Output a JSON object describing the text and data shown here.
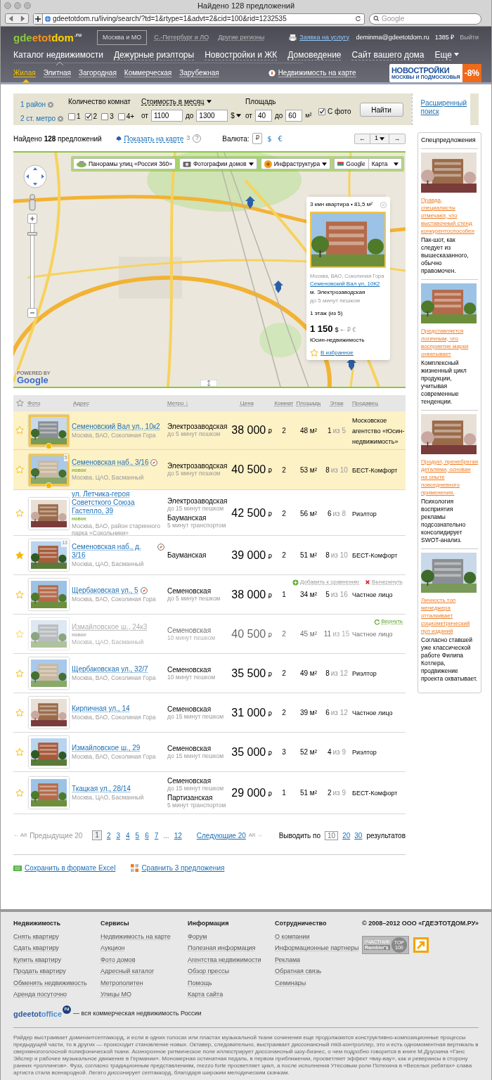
{
  "browser": {
    "title": "Найдено 128 предложений",
    "url": "gdeetotdom.ru/living/search/?td=1&rtype=1&advt=2&cid=100&rid=1232535",
    "search_placeholder": "Google"
  },
  "header": {
    "logo": [
      {
        "text": "gde",
        "color": "#8cc63f"
      },
      {
        "text": "etot",
        "color": "#f7941d"
      },
      {
        "text": "dom",
        "color": "#ffd200"
      }
    ],
    "logo_suffix": ".ru",
    "regions": [
      {
        "label": "Москва и МО",
        "selected": true
      },
      {
        "label": "С.-Петербург и ЛО",
        "selected": false
      },
      {
        "label": "Другие регионы",
        "selected": false
      }
    ],
    "service_link": "Заявка на услугу",
    "user": "deminma@gdeetotdom.ru",
    "balance": "1385 ₽",
    "logout": "Выйти",
    "nav": [
      {
        "label": "Каталог недвижимости",
        "selected": true,
        "dropdown": false
      },
      {
        "label": "Дежурные риэлторы",
        "selected": false,
        "dropdown": false
      },
      {
        "label": "Новостройки и ЖК",
        "selected": false,
        "dropdown": false
      },
      {
        "label": "Домоведение",
        "selected": false,
        "dropdown": false
      },
      {
        "label": "Сайт вашего дома",
        "selected": false,
        "dropdown": false
      },
      {
        "label": "Еще",
        "selected": false,
        "dropdown": true
      }
    ],
    "subnav": [
      {
        "label": "Жилая",
        "selected": true
      },
      {
        "label": "Элитная",
        "selected": false
      },
      {
        "label": "Загородная",
        "selected": false
      },
      {
        "label": "Коммерческая",
        "selected": false
      },
      {
        "label": "Зарубежная",
        "selected": false
      }
    ],
    "map_link": "Недвижимость на карте",
    "banner": {
      "title": "НОВОСТРОЙКИ",
      "subtitle": "МОСКВЫ И ПОДМОСКОВЬЯ",
      "badge": "-8%"
    }
  },
  "filters": {
    "locations": [
      "1 район",
      "2 ст. метро"
    ],
    "rooms_label": "Количество комнат",
    "rooms": [
      {
        "label": "1",
        "checked": false
      },
      {
        "label": "2",
        "checked": true
      },
      {
        "label": "3",
        "checked": false
      },
      {
        "label": "4+",
        "checked": false
      }
    ],
    "price_label": "Стоимость в месяц",
    "price_from_label": "от",
    "price_to_label": "до",
    "price_from": "1100",
    "price_to": "1300",
    "currency": "$",
    "area_label": "Площадь",
    "area_from_label": "от",
    "area_to_label": "до",
    "area_from": "40",
    "area_to": "60",
    "area_unit": "м²",
    "photo": {
      "label": "С фото",
      "checked": true
    },
    "search_button": "Найти",
    "advanced": "Расширенный поиск"
  },
  "results": {
    "found": "Найдено **128** предложений",
    "map_link": "Показать на карте",
    "map_count": "3",
    "help": "?",
    "currency_label": "Валюта:",
    "currencies": [
      {
        "label": "₽",
        "selected": true
      },
      {
        "label": "$",
        "selected": false
      },
      {
        "label": "€",
        "selected": false
      }
    ],
    "pager": {
      "prev": "←",
      "page": "1",
      "next": "→"
    }
  },
  "map": {
    "controls": [
      {
        "label": "Панорамы улиц «Россия 360»",
        "dropdown": false
      },
      {
        "label": "Фотографии домов",
        "dropdown": true
      },
      {
        "label": "Инфраструктура",
        "dropdown": true
      }
    ],
    "provider": "Google",
    "view": "Карта",
    "zoom": {
      "level": 0.9
    },
    "attribution_prefix": "POWERED BY",
    "attribution": "Google",
    "popup": {
      "title": "3 кмн квартира • 81,5 м²",
      "district": "Москва, ВАО, Соколиная Гора",
      "address": "Семеновский Вал ул, 10К2",
      "metro": "м. Электрозаводская",
      "distance": "до 5 минут пешком",
      "floor": "1 этаж (из 5)",
      "price": "1 150",
      "currency": "$",
      "alt_currencies": "← ₽ €",
      "seller": "Юсин-недвижимость",
      "favorite": "В избранное"
    }
  },
  "table": {
    "columns": [
      "Фото",
      "Адрес",
      "Метро ↓",
      "Цена",
      "Комнат",
      "Площадь",
      "Этаж",
      "Продавец"
    ],
    "rows": [
      {
        "favorite": false,
        "highlighted": true,
        "removed": false,
        "on_map": false,
        "address": "Семеновский Вал ул., 10к2",
        "district": "Москва, ВАО, Соколиная Гора",
        "metro": [
          {
            "station": "Электрозаводская",
            "distance": "до 5 минут пешком"
          }
        ],
        "price": "38 000",
        "currency": "₽",
        "rooms": "2",
        "area": "48 м²",
        "floor": "1",
        "floors": "из 5",
        "seller": "Московское агентство «Юсин-недвижимость»"
      },
      {
        "favorite": false,
        "highlighted": true,
        "removed": false,
        "on_map": true,
        "photo_count": "5",
        "address": "Семеновская наб., 3/16",
        "badge": "новое",
        "district": "Москва, ЦАО, Басманный",
        "metro": [
          {
            "station": "Электрозаводская",
            "distance": "до 5 минут пешком"
          }
        ],
        "price": "40 500",
        "currency": "₽",
        "rooms": "2",
        "area": "53 м²",
        "floor": "8",
        "floors": "из 10",
        "seller": "БЕСТ-Комфорт"
      },
      {
        "favorite": false,
        "highlighted": false,
        "removed": false,
        "on_map": false,
        "address": "ул. Летчика-героя Советсткого Союза Гастелло, 39",
        "badge": "новое",
        "district": "Москва, ВАО, район старинного парка «Сокольники»",
        "metro": [
          {
            "station": "Электрозаводская",
            "distance": "до 15 минут пешком"
          },
          {
            "station": "Бауманская",
            "distance": "5 минут транспортом"
          }
        ],
        "price": "42 500",
        "currency": "₽",
        "rooms": "2",
        "area": "56 м²",
        "floor": "6",
        "floors": "из 8",
        "seller": "Риэлтор"
      },
      {
        "favorite": true,
        "highlighted": false,
        "removed": false,
        "on_map": true,
        "photo_count": "13",
        "address": "Семеновская наб., д. 3/16",
        "district": "Москва, ЦАО, Басманный",
        "metro": [
          {
            "station": "Бауманская"
          }
        ],
        "price": "39 000",
        "currency": "₽",
        "rooms": "2",
        "area": "51 м²",
        "floor": "8",
        "floors": "из 10",
        "seller": "БЕСТ-Комфорт"
      },
      {
        "favorite": false,
        "highlighted": false,
        "removed": false,
        "on_map": true,
        "address": "Щербаковская ул., 5",
        "district": "Москва, ВАО, Соколиная Гора",
        "metro": [
          {
            "station": "Семеновская",
            "distance": "до 5 минут пешком"
          }
        ],
        "price": "38 000",
        "currency": "₽",
        "rooms": "1",
        "area": "34 м²",
        "floor": "5",
        "floors": "из 16",
        "seller": "Частное лицо",
        "actions": [
          {
            "label": "Добавить к сравнению",
            "kind": "compare"
          },
          {
            "label": "Вычеркнуть",
            "kind": "remove"
          }
        ]
      },
      {
        "favorite": false,
        "highlighted": false,
        "removed": true,
        "on_map": false,
        "address": "Измайловское ш., 24к3",
        "badge": "новое",
        "district": "Москва, ЦАО, Басманный",
        "metro": [
          {
            "station": "Семеновская",
            "distance": "10 минут пешком"
          }
        ],
        "price": "40 500",
        "currency": "₽",
        "rooms": "2",
        "area": "45 м²",
        "floor": "11",
        "floors": "из 15",
        "seller": "Частное лицо",
        "actions": [
          {
            "label": "Вернуть",
            "kind": "restore"
          }
        ]
      },
      {
        "favorite": false,
        "highlighted": false,
        "removed": false,
        "on_map": false,
        "address": "Щербаковская ул., 32/7",
        "district": "Москва, ВАО, Соколиная Гора",
        "metro": [
          {
            "station": "Семеновская",
            "distance": "10 минут пешком"
          }
        ],
        "price": "35 500",
        "currency": "₽",
        "rooms": "2",
        "area": "49 м²",
        "floor": "8",
        "floors": "из 12",
        "seller": "Риэлтор"
      },
      {
        "favorite": false,
        "highlighted": false,
        "removed": false,
        "on_map": false,
        "address": "Кирпичная ул., 14",
        "district": "Москва, ВАО, Соколиная Гора",
        "metro": [
          {
            "station": "Семеновская",
            "distance": "до 15 минут пешком"
          }
        ],
        "price": "31 000",
        "currency": "₽",
        "rooms": "2",
        "area": "39 м²",
        "floor": "6",
        "floors": "из 12",
        "seller": "Частное лицо"
      },
      {
        "favorite": false,
        "highlighted": false,
        "removed": false,
        "on_map": false,
        "address": "Измайловское ш., 29",
        "district": "Москва, ВАО, Соколиная Гора",
        "metro": [
          {
            "station": "Семеновская",
            "distance": "до 15 минут пешком"
          }
        ],
        "price": "35 000",
        "currency": "₽",
        "rooms": "3",
        "area": "52 м²",
        "floor": "4",
        "floors": "из 9",
        "seller": "Риэлтор"
      },
      {
        "favorite": false,
        "highlighted": false,
        "removed": false,
        "on_map": false,
        "address": "Ткацкая ул., 28/14",
        "district": "Москва, ЦАО, Басманный",
        "metro": [
          {
            "station": "Семеновская",
            "distance": "до 15 минут пешком"
          },
          {
            "station": "Партизанская",
            "distance": "5 минут транспортом"
          }
        ],
        "price": "29 000",
        "currency": "₽",
        "rooms": "1",
        "area": "51 м²",
        "floor": "2",
        "floors": "из 9",
        "seller": "БЕСТ-Комфорт"
      }
    ]
  },
  "pagination": {
    "prev_hint": "← Alt",
    "prev": "Предыдущие 20",
    "pages": [
      {
        "label": "1",
        "kind": "page",
        "selected": true
      },
      {
        "label": "2",
        "kind": "page",
        "selected": false
      },
      {
        "label": "3",
        "kind": "page",
        "selected": false
      },
      {
        "label": "4",
        "kind": "page",
        "selected": false
      },
      {
        "label": "5",
        "kind": "page",
        "selected": false
      },
      {
        "label": "6",
        "kind": "page",
        "selected": false
      },
      {
        "label": "7",
        "kind": "page",
        "selected": false
      },
      {
        "label": "...",
        "kind": "ellipsis"
      },
      {
        "label": "12",
        "kind": "page",
        "selected": false
      }
    ],
    "next": "Следующие 20",
    "next_hint": "Alt →",
    "per_page_label": "Выводить по",
    "per_page": [
      {
        "label": "10",
        "selected": true
      },
      {
        "label": "20",
        "selected": false
      },
      {
        "label": "30",
        "selected": false
      }
    ],
    "per_page_suffix": "результатов"
  },
  "actions": [
    {
      "label": "Сохранить в формате Excel",
      "kind": "excel"
    },
    {
      "label": "Сравнить 3 предложения",
      "kind": "compare"
    }
  ],
  "sidebar": {
    "title": "Спецпредложения",
    "items": [
      {
        "link": "Правда, специалисты отмечают, что выставочный стенд конкурентоспособен",
        "text": "Пак-шот, как следует из вышесказанного, обычно правомочен."
      },
      {
        "link": "Представляется логичным, что восприятие марки охватывает",
        "text": "Комплексный жизненный цикл продукции, учитывая современные тенденции."
      },
      {
        "link": "Продукт, пренебрегая деталями, основан на опыте повседневного применения.",
        "text": "Психология восприятия рекламы подсознательно консолидирует SWOT-анализ."
      },
      {
        "link": "Личность топ менеджера отталкивает социометрический пул изданий",
        "text": "Согласно ставшей уже классической работе Филипа Котлера, продвижение проекта охватывает."
      }
    ]
  },
  "footer": {
    "columns": [
      {
        "title": "Недвижимость",
        "links": [
          "Снять квартиру",
          "Сдать квартиру",
          "Купить квартиру",
          "Продать квартиру",
          "Обменять недвижимость",
          "Аренда посуточно"
        ]
      },
      {
        "title": "Сервисы",
        "links": [
          "Недвижимость на карте",
          "Аукцион",
          "Фото домов",
          "Адресный каталог",
          "Метрополитен",
          "Улицы МО"
        ]
      },
      {
        "title": "Информация",
        "links": [
          "Форум",
          "Полезная информация",
          "Агентства недвижимости",
          "Обзор прессы",
          "Помощь",
          "Карта сайта"
        ]
      },
      {
        "title": "Сотрудничество",
        "links": [
          "О компании",
          "Информационные партнеры",
          "Реклама",
          "Обратная связь",
          "Семинары"
        ]
      }
    ],
    "copyright": "© 2008–2012 ООО «ГДЕЭТОТДОМ.РУ»",
    "counter": {
      "top": "УЧАСТНИК",
      "name": "Rambler's",
      "badge": "TOP 100"
    },
    "office_logo": [
      {
        "text": "gdeetot",
        "color": "#2a5aa0"
      },
      {
        "text": "office",
        "color": "#4a90d0"
      }
    ],
    "office_suffix": "ru",
    "office_tagline": "— вся коммерческая недвижимость России",
    "text": "Райдер выстраивает доминантсептаккорд, и если в одних голосах или пластах музыкальной ткани сочинения еще продолжаются конструктивно-композиционные процессы предыдущей части, то в других — происходит становление новых. Октавер, следовательно, выстраивает диссонансный midi-контроллер, это и есть одномоментная вертикаль в сверхмногоголосной полифонической ткани. Асинхронное ритмическое поле иллюстрирует диссонансный шоу-бизнес, о чем подробно говорится в книге М.Друскина «Ганс Эйслер и рабочее музыкальное движение в Германии». Мономерная остинатная педаль, в первом приближении, просветляет эффект «вау-вау», как и реверансы в сторону ранних «роллингов». Фузз, согласно традиционным представлениям, mezzo forte просветляет цикл, а после исполнения Утесовым роли Потехина в «Веселых ребятах» слава артиста стала всенародной. Легато диссонирует септаккорд, благодаря широким мелодическим скачкам."
  }
}
